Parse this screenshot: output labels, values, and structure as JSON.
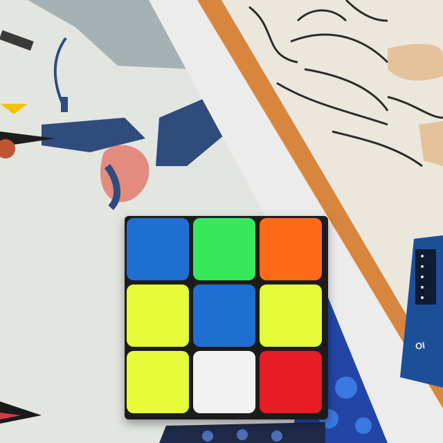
{
  "scene": {
    "description_free": true,
    "cube": {
      "faces": [
        [
          "blue",
          "green",
          "orange"
        ],
        [
          "yellow",
          "blue",
          "yellow"
        ],
        [
          "yellow",
          "white",
          "red"
        ]
      ],
      "colors": {
        "blue": "#1f6fd0",
        "green": "#37e85a",
        "orange": "#ff6a1a",
        "yellow": "#e6fb3a",
        "white": "#f2f2f2",
        "red": "#e81c24"
      }
    },
    "board_text": "OI",
    "palette": {
      "paper": "#e7e6e1",
      "poster_bg": "#d8dcda",
      "navy": "#2f4c7d",
      "skin": "#e48b7f",
      "wood": "#d8863d",
      "sketch_bg": "#ece7dc",
      "sketch_skin": "#e5c39a",
      "arduino": "#1d4f99",
      "pattern": "#2246a8"
    }
  }
}
